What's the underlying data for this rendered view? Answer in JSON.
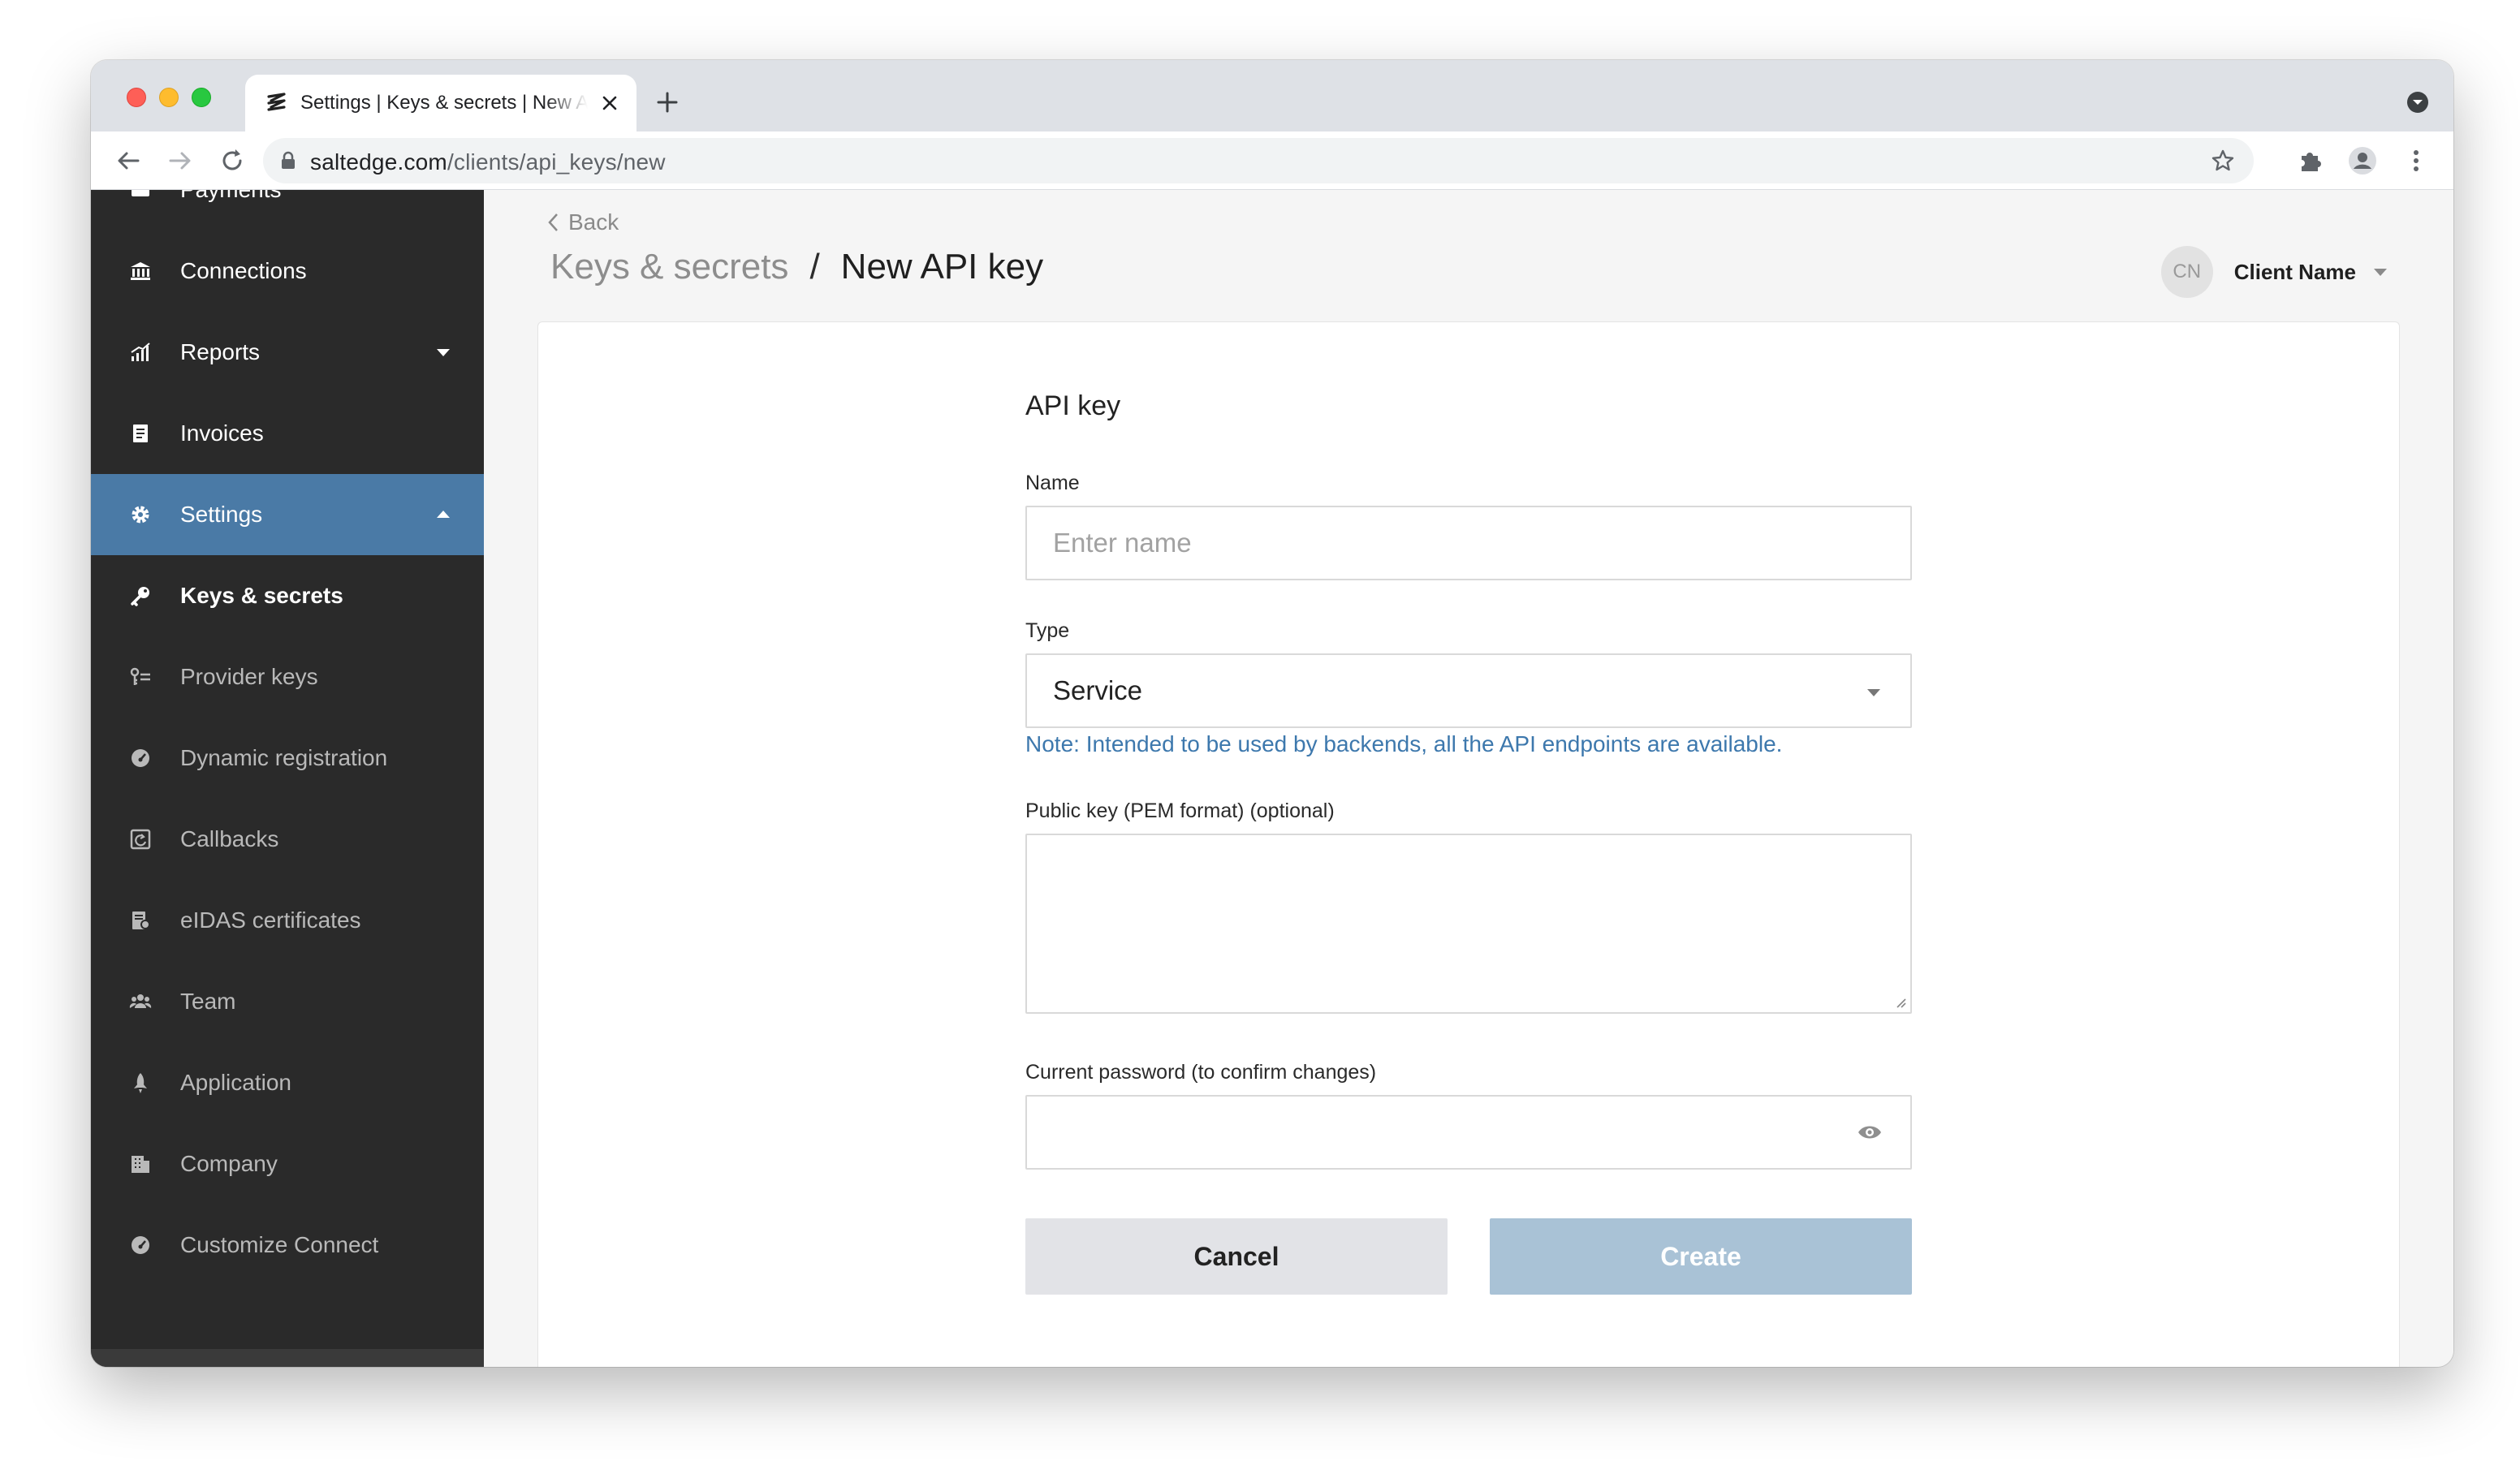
{
  "browser": {
    "tab_title": "Settings | Keys & secrets | New API key",
    "url_host": "saltedge.com",
    "url_path": "/clients/api_keys/new"
  },
  "sidebar": {
    "items": [
      {
        "label": "Payments",
        "icon": "payments-icon"
      },
      {
        "label": "Connections",
        "icon": "bank-icon"
      },
      {
        "label": "Reports",
        "icon": "chart-icon",
        "expandable": true
      },
      {
        "label": "Invoices",
        "icon": "invoice-icon"
      },
      {
        "label": "Settings",
        "icon": "gear-icon",
        "expandable": true,
        "active": true
      },
      {
        "label": "Keys & secrets",
        "icon": "key-icon",
        "current": true
      },
      {
        "label": "Provider keys",
        "icon": "provider-key-icon"
      },
      {
        "label": "Dynamic registration",
        "icon": "gauge-icon"
      },
      {
        "label": "Callbacks",
        "icon": "callback-icon"
      },
      {
        "label": "eIDAS certificates",
        "icon": "certificate-icon"
      },
      {
        "label": "Team",
        "icon": "team-icon"
      },
      {
        "label": "Application",
        "icon": "rocket-icon"
      },
      {
        "label": "Company",
        "icon": "building-icon"
      },
      {
        "label": "Customize Connect",
        "icon": "palette-icon"
      }
    ]
  },
  "header": {
    "back_label": "Back",
    "breadcrumb_parent": "Keys & secrets",
    "breadcrumb_separator": "/",
    "breadcrumb_current": "New API key",
    "user_initials": "CN",
    "user_name": "Client Name"
  },
  "form": {
    "title": "API key",
    "name_label": "Name",
    "name_placeholder": "Enter name",
    "type_label": "Type",
    "type_value": "Service",
    "type_note": "Note: Intended to be used by backends, all the API endpoints are available.",
    "public_key_label": "Public key (PEM format) (optional)",
    "password_label": "Current password (to confirm changes)",
    "cancel_label": "Cancel",
    "create_label": "Create"
  },
  "colors": {
    "sidebar_bg": "#2a2a2a",
    "sidebar_active": "#4a7aa6",
    "note_text": "#3d78ad",
    "create_button": "#a9c2d6",
    "cancel_button": "#e2e3e7"
  }
}
